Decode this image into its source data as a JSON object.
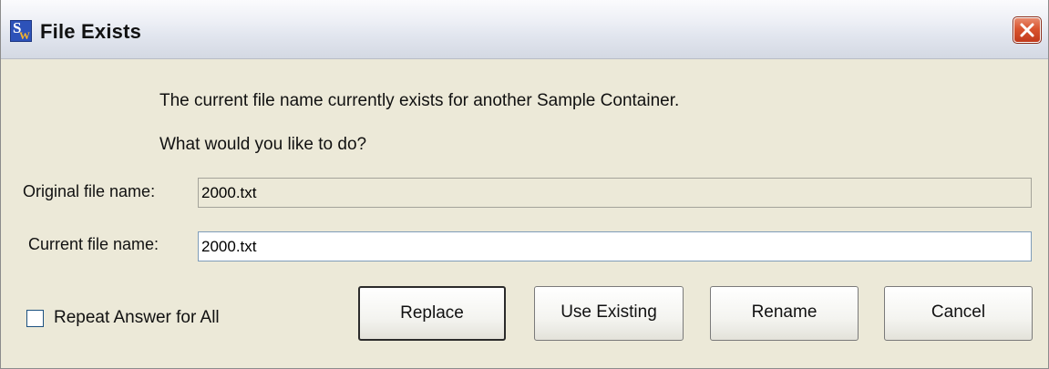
{
  "window": {
    "title": "File Exists",
    "icon": "sw-app-icon",
    "close_icon": "close-icon"
  },
  "message": {
    "line1": "The current file name currently exists for another Sample Container.",
    "line2": "What would you like to do?"
  },
  "fields": {
    "original_label": "Original file name:",
    "original_value": "2000.txt",
    "current_label": "Current file name:",
    "current_value": "2000.txt"
  },
  "checkbox": {
    "label": "Repeat Answer for All",
    "checked": false
  },
  "buttons": {
    "replace": "Replace",
    "use_existing": "Use Existing",
    "rename": "Rename",
    "cancel": "Cancel"
  },
  "colors": {
    "dialog_bg": "#ece9d8",
    "close_button": "#d9542f"
  }
}
